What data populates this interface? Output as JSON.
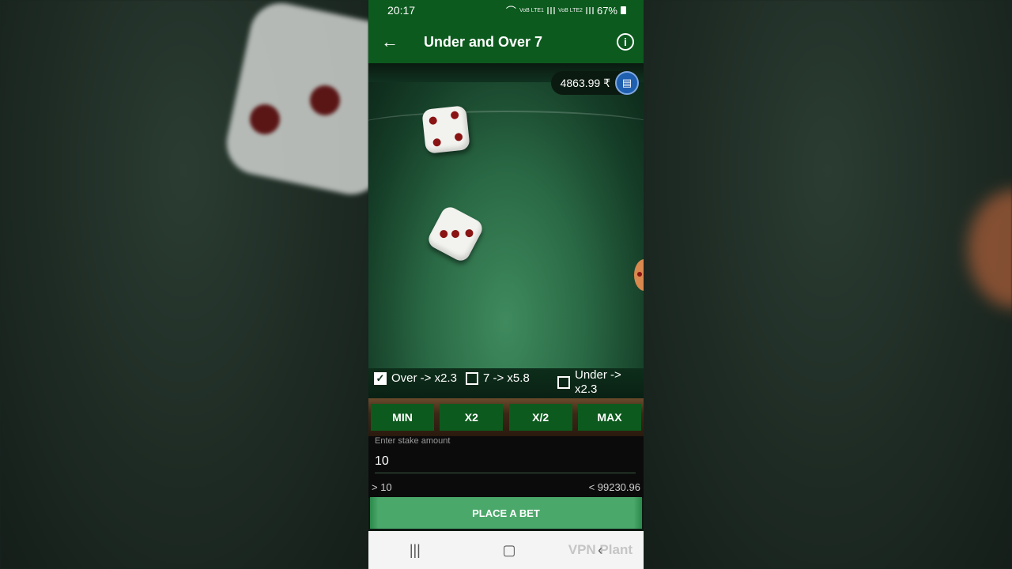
{
  "status_bar": {
    "time": "20:17",
    "net1": "VoB LTE1",
    "net2": "VoB LTE2",
    "battery": "67%"
  },
  "header": {
    "title": "Under and Over 7",
    "back_icon": "arrow-left-icon",
    "info_icon": "info-icon"
  },
  "balance": {
    "amount": "4863.99 ₹",
    "icon": "wallet-icon"
  },
  "dice": [
    {
      "value": 4
    },
    {
      "value": 3
    }
  ],
  "bet_options": [
    {
      "label": "Over -> x2.3",
      "checked": true
    },
    {
      "label": "7 -> x5.8",
      "checked": false
    },
    {
      "label": "Under -> x2.3",
      "checked": false
    }
  ],
  "stake_buttons": [
    "MIN",
    "X2",
    "X/2",
    "MAX"
  ],
  "stake": {
    "label": "Enter stake amount",
    "value": "10",
    "min": "> 10",
    "max": "< 99230.96"
  },
  "place_bet": "PLACE A BET",
  "watermark": "VPN Plant",
  "colors": {
    "header": "#0c5a1e",
    "button": "#0d5a1e",
    "place_bet": "#4aa86a",
    "wallet": "#1e5fb0"
  }
}
